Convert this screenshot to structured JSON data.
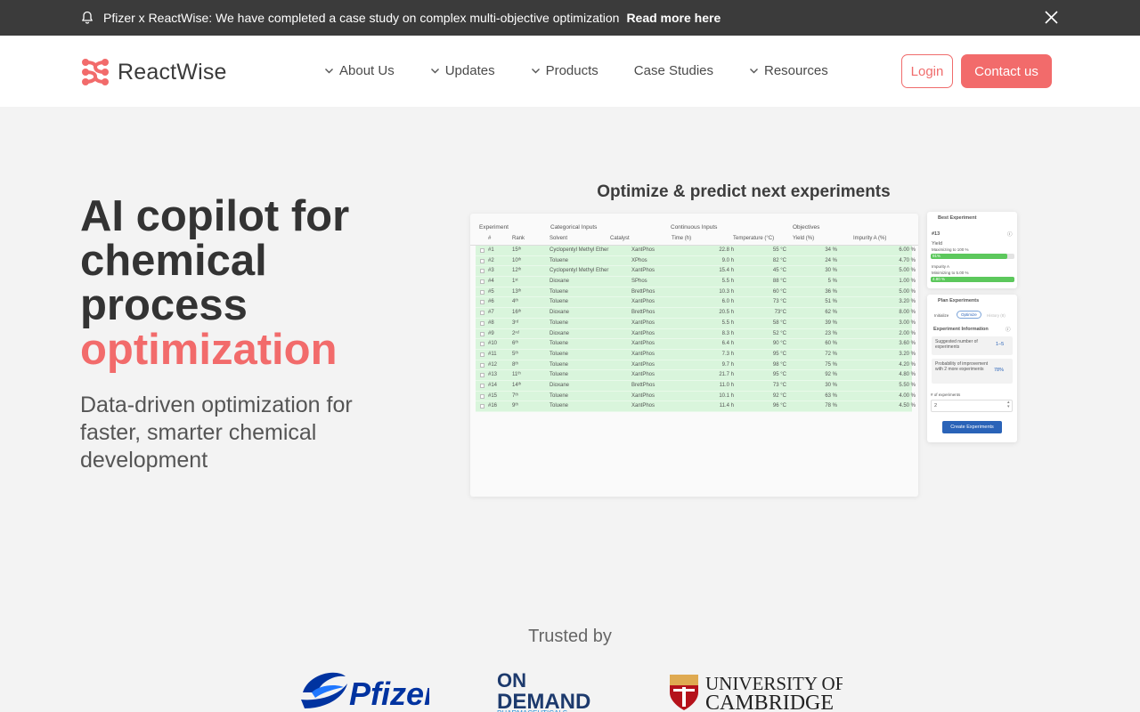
{
  "announcement": {
    "message": "Pfizer x ReactWise: We have completed a case study on complex multi-objective optimization",
    "link": "Read more here",
    "bell_icon": "bell-icon",
    "close_icon": "close-icon"
  },
  "header": {
    "brand": "ReactWise",
    "nav": [
      {
        "label": "About Us",
        "dropdown": true
      },
      {
        "label": "Updates",
        "dropdown": true
      },
      {
        "label": "Products",
        "dropdown": true
      },
      {
        "label": "Case Studies",
        "dropdown": false
      },
      {
        "label": "Resources",
        "dropdown": true
      }
    ],
    "login": "Login",
    "contact": "Contact us"
  },
  "hero": {
    "title_line1": "AI copilot for",
    "title_line2": "chemical",
    "title_line3": "process",
    "title_accent": "optimization",
    "subtitle": "Data-driven optimization for faster, smarter chemical development"
  },
  "panel": {
    "title": "Optimize & predict next experiments",
    "groups": [
      "Experiment",
      "Categorical Inputs",
      "Continuous Inputs",
      "Objectives"
    ],
    "columns": [
      "#",
      "Rank",
      "Solvent",
      "Catalyst",
      "Time (h)",
      "Temperature (°C)",
      "Yield (%)",
      "Impurity A (%)"
    ],
    "rows": [
      [
        "#1",
        "15ᵗʰ",
        "Cyclopentyl Methyl Ether",
        "XantPhos",
        "22.8 h",
        "55 °C",
        "34 %",
        "6.00 %"
      ],
      [
        "#2",
        "10ᵗʰ",
        "Toluene",
        "XPhos",
        "9.0 h",
        "82 °C",
        "24 %",
        "4.70 %"
      ],
      [
        "#3",
        "12ᵗʰ",
        "Cyclopentyl Methyl Ether",
        "XantPhos",
        "15.4 h",
        "45 °C",
        "30 %",
        "5.00 %"
      ],
      [
        "#4",
        "1ˢᵗ",
        "Dioxane",
        "SPhos",
        "5.5 h",
        "88 °C",
        "5 %",
        "1.00 %"
      ],
      [
        "#5",
        "13ᵗʰ",
        "Toluene",
        "BrettPhos",
        "10.3 h",
        "60 °C",
        "36 %",
        "5.00 %"
      ],
      [
        "#6",
        "4ᵗʰ",
        "Toluene",
        "XantPhos",
        "6.0 h",
        "73 °C",
        "51 %",
        "3.20 %"
      ],
      [
        "#7",
        "16ᵗʰ",
        "Dioxane",
        "BrettPhos",
        "20.5 h",
        "73°C",
        "62 %",
        "8.00 %"
      ],
      [
        "#8",
        "3ʳᵈ",
        "Toluene",
        "XantPhos",
        "5.5 h",
        "58 °C",
        "39 %",
        "3.00 %"
      ],
      [
        "#9",
        "2ⁿᵈ",
        "Dioxane",
        "XantPhos",
        "8.3 h",
        "52 °C",
        "23 %",
        "2.00 %"
      ],
      [
        "#10",
        "6ᵗʰ",
        "Toluene",
        "XantPhos",
        "6.4 h",
        "90 °C",
        "60 %",
        "3.60 %"
      ],
      [
        "#11",
        "5ᵗʰ",
        "Toluene",
        "XantPhos",
        "7.3 h",
        "95 °C",
        "72 %",
        "3.20 %"
      ],
      [
        "#12",
        "8ᵗʰ",
        "Toluene",
        "XantPhos",
        "9.7 h",
        "98 °C",
        "75 %",
        "4.20 %"
      ],
      [
        "#13",
        "11ᵗʰ",
        "Toluene",
        "XantPhos",
        "21.7 h",
        "95 °C",
        "92 %",
        "4.80 %"
      ],
      [
        "#14",
        "14ᵗʰ",
        "Dioxane",
        "BrettPhos",
        "11.0 h",
        "73 °C",
        "30 %",
        "5.50 %"
      ],
      [
        "#15",
        "7ᵗʰ",
        "Toluene",
        "XantPhos",
        "10.1 h",
        "92 °C",
        "63 %",
        "4.00 %"
      ],
      [
        "#16",
        "9ᵗʰ",
        "Toluene",
        "XantPhos",
        "11.4 h",
        "96 °C",
        "78 %",
        "4.50 %"
      ]
    ],
    "best": {
      "title": "Best Experiment",
      "id": "#13",
      "yield_label": "Yield",
      "yield_goal": "Maximizing to 100 %",
      "yield_value": "91%",
      "yield_fill": 0.91,
      "impurity_label": "Impurity A",
      "impurity_goal": "Minimizing to 5.00 %",
      "impurity_value": "4.80 %",
      "impurity_fill": 1.0
    },
    "plan": {
      "title": "Plan Experiments",
      "tabs": [
        "Initialize",
        "Optimize",
        "History (8)"
      ],
      "info_title": "Experiment Information",
      "suggested_label": "Suggested number of experiments",
      "suggested_value": "1–5",
      "prob_label": "Probability of improvement with 2 more experiments",
      "prob_value": "78%",
      "count_label": "# of experiments",
      "count_value": "2",
      "create": "Create Experiments"
    }
  },
  "trusted": {
    "label": "Trusted by",
    "logos": [
      "Pfizer",
      "ON DEMAND",
      "PHARMACEUTICALS",
      "UNIVERSITY OF",
      "CAMBRIDGE"
    ]
  },
  "colors": {
    "accent": "#f26b6b",
    "row_green": "#d9f5dc",
    "bar_green": "#5cc85c",
    "button_blue": "#2a63b8"
  }
}
